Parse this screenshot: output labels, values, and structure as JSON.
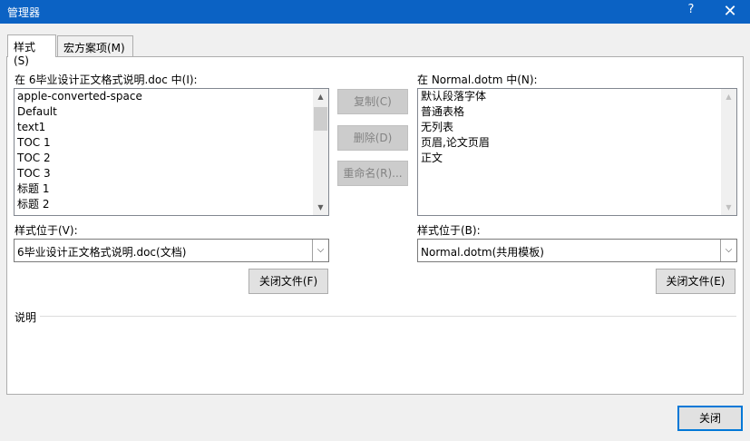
{
  "window": {
    "title": "管理器",
    "help_label": "?",
    "close_label": "✕"
  },
  "tabs": [
    {
      "label": "样式(S)",
      "active": true
    },
    {
      "label": "宏方案项(M)",
      "active": false
    }
  ],
  "left": {
    "list_label": "在 6毕业设计正文格式说明.doc 中(I):",
    "items": [
      "apple-converted-space",
      "Default",
      "text1",
      "TOC 1",
      "TOC 2",
      "TOC 3",
      "标题 1",
      "标题 2"
    ],
    "location_label": "样式位于(V):",
    "location_value": "6毕业设计正文格式说明.doc(文档)",
    "close_file_label": "关闭文件(F)"
  },
  "right": {
    "list_label": "在 Normal.dotm 中(N):",
    "items": [
      "默认段落字体",
      "普通表格",
      "无列表",
      "页眉,论文页眉",
      "正文"
    ],
    "location_label": "样式位于(B):",
    "location_value": "Normal.dotm(共用模板)",
    "close_file_label": "关闭文件(E)"
  },
  "middle": {
    "copy_label": "复制(C)",
    "delete_label": "删除(D)",
    "rename_label": "重命名(R)..."
  },
  "description": {
    "label": "说明"
  },
  "footer": {
    "close_label": "关闭"
  },
  "icons": {
    "scroll_up": "▲",
    "scroll_down": "▼",
    "combo_arrow": "⌵"
  }
}
